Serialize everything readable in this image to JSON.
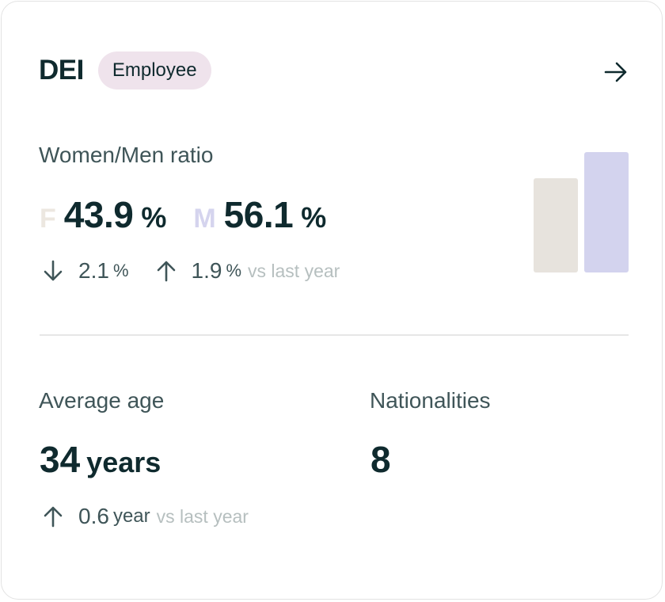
{
  "header": {
    "title": "DEI",
    "badge": "Employee"
  },
  "ratio": {
    "label": "Women/Men ratio",
    "female": {
      "letter": "F",
      "value": "43.9",
      "unit": "%",
      "change": "2.1",
      "change_unit": "%",
      "direction": "down",
      "share": 0.439
    },
    "male": {
      "letter": "M",
      "value": "56.1",
      "unit": "%",
      "change": "1.9",
      "change_unit": "%",
      "direction": "up",
      "share": 0.561
    },
    "compare_text": "vs last year",
    "colors": {
      "female": "#e7e3dd",
      "male": "#d3d3ee"
    }
  },
  "average_age": {
    "label": "Average age",
    "value": "34",
    "unit": "years",
    "change": "0.6",
    "change_unit": "year",
    "direction": "up",
    "compare_text": "vs last year"
  },
  "nationalities": {
    "label": "Nationalities",
    "value": "8"
  },
  "icons": {
    "open": "arrow-right-icon",
    "decrease": "arrow-down-icon",
    "increase": "arrow-up-icon"
  }
}
